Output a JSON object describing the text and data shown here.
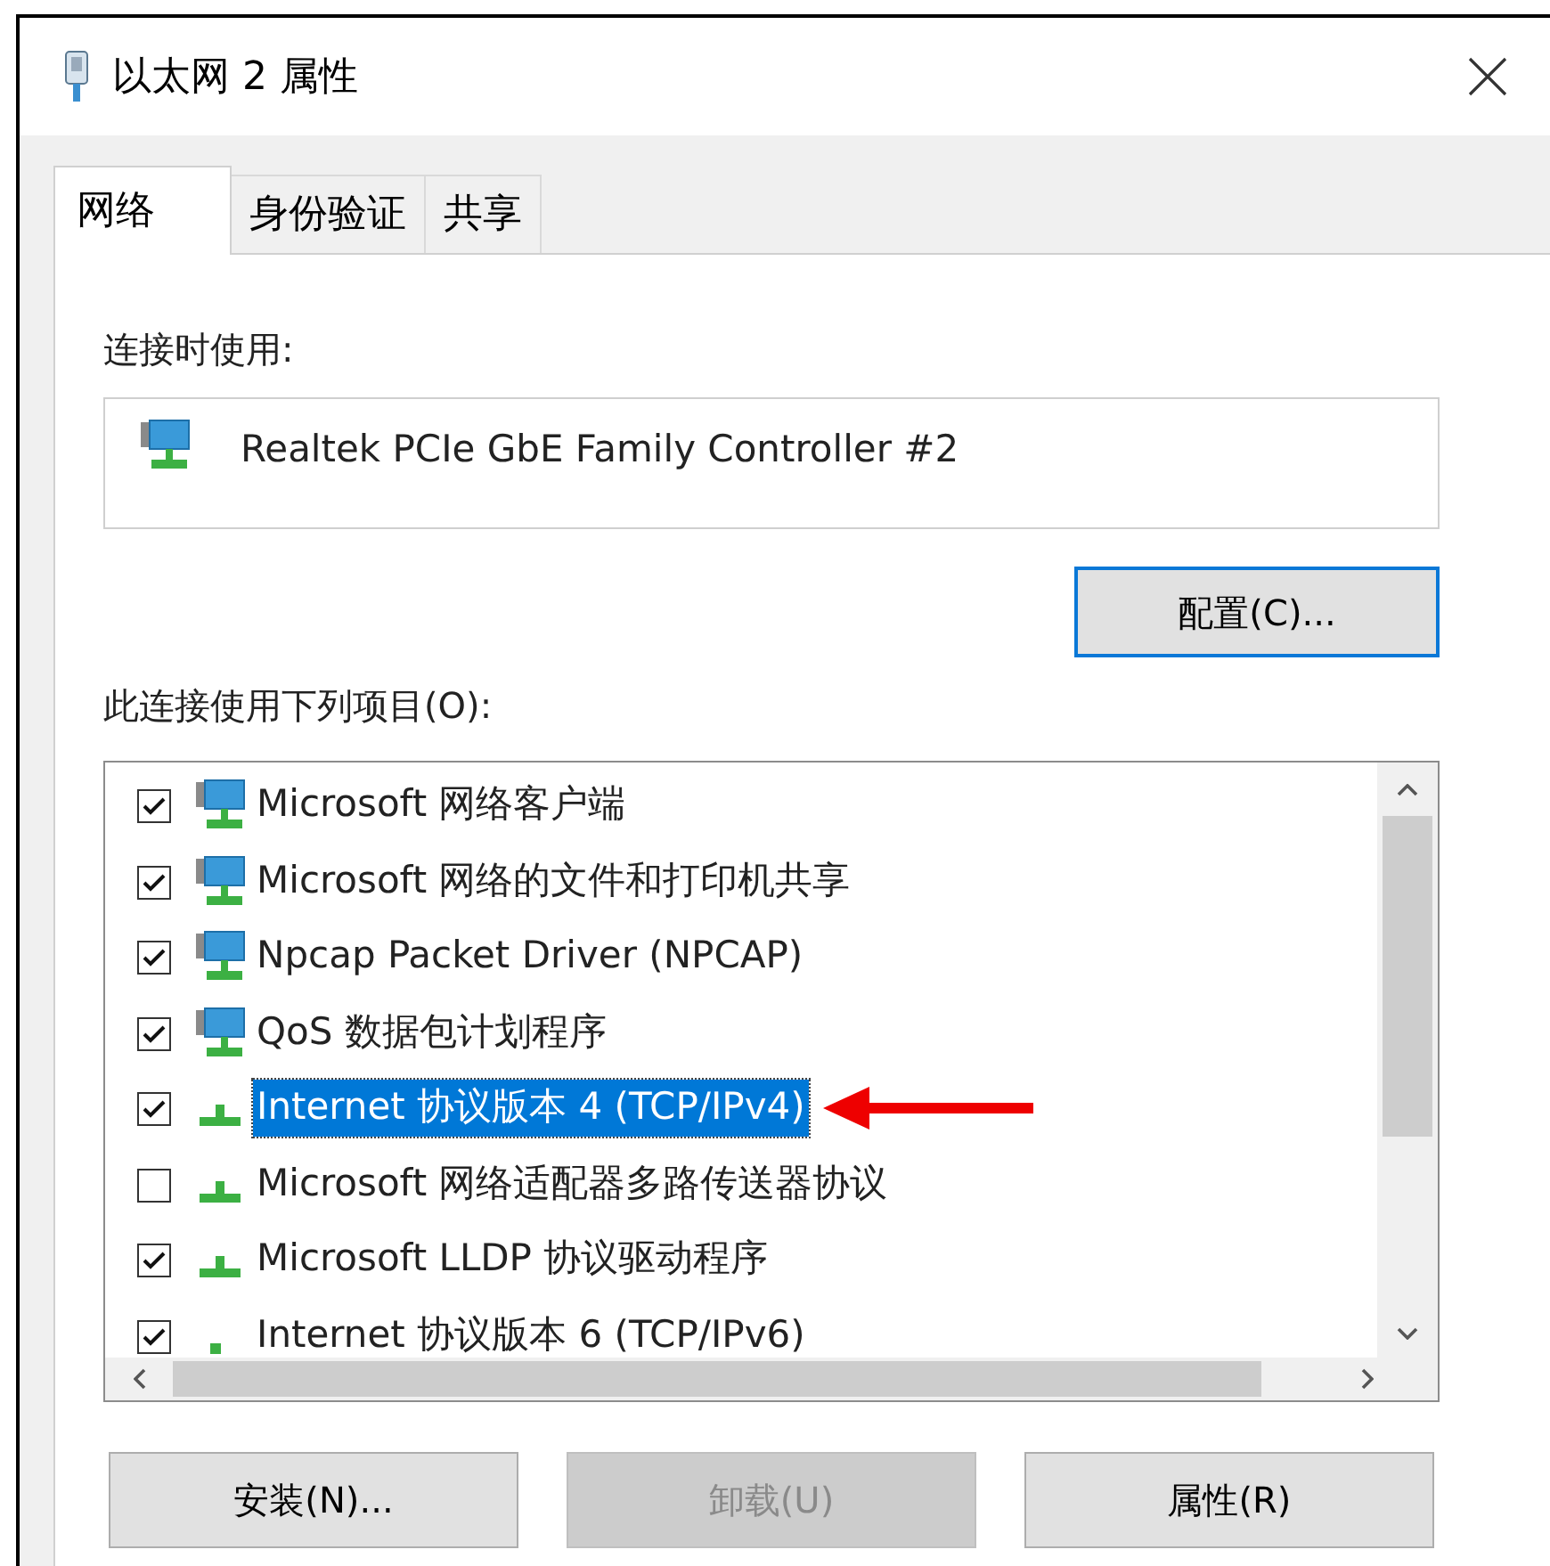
{
  "window": {
    "title": "以太网 2 属性"
  },
  "tabs": [
    {
      "label": "网络",
      "selected": true
    },
    {
      "label": "身份验证",
      "selected": false
    },
    {
      "label": "共享",
      "selected": false
    }
  ],
  "connect_using": {
    "label": "连接时使用:",
    "adapter": "Realtek PCIe GbE Family Controller #2",
    "configure_button": "配置(C)..."
  },
  "items_label": "此连接使用下列项目(O):",
  "items": [
    {
      "label": "Microsoft 网络客户端",
      "checked": true,
      "selected": false,
      "kind": "service"
    },
    {
      "label": "Microsoft 网络的文件和打印机共享",
      "checked": true,
      "selected": false,
      "kind": "service"
    },
    {
      "label": "Npcap Packet Driver (NPCAP)",
      "checked": true,
      "selected": false,
      "kind": "service"
    },
    {
      "label": "QoS 数据包计划程序",
      "checked": true,
      "selected": false,
      "kind": "service"
    },
    {
      "label": "Internet 协议版本 4 (TCP/IPv4)",
      "checked": true,
      "selected": true,
      "kind": "protocol"
    },
    {
      "label": "Microsoft 网络适配器多路传送器协议",
      "checked": false,
      "selected": false,
      "kind": "protocol"
    },
    {
      "label": "Microsoft LLDP 协议驱动程序",
      "checked": true,
      "selected": false,
      "kind": "protocol"
    },
    {
      "label": "Internet 协议版本 6 (TCP/IPv6)",
      "checked": true,
      "selected": false,
      "kind": "protocol"
    }
  ],
  "buttons": [
    {
      "label": "安装(N)...",
      "disabled": false
    },
    {
      "label": "卸载(U)",
      "disabled": true
    },
    {
      "label": "属性(R)",
      "disabled": false
    }
  ]
}
